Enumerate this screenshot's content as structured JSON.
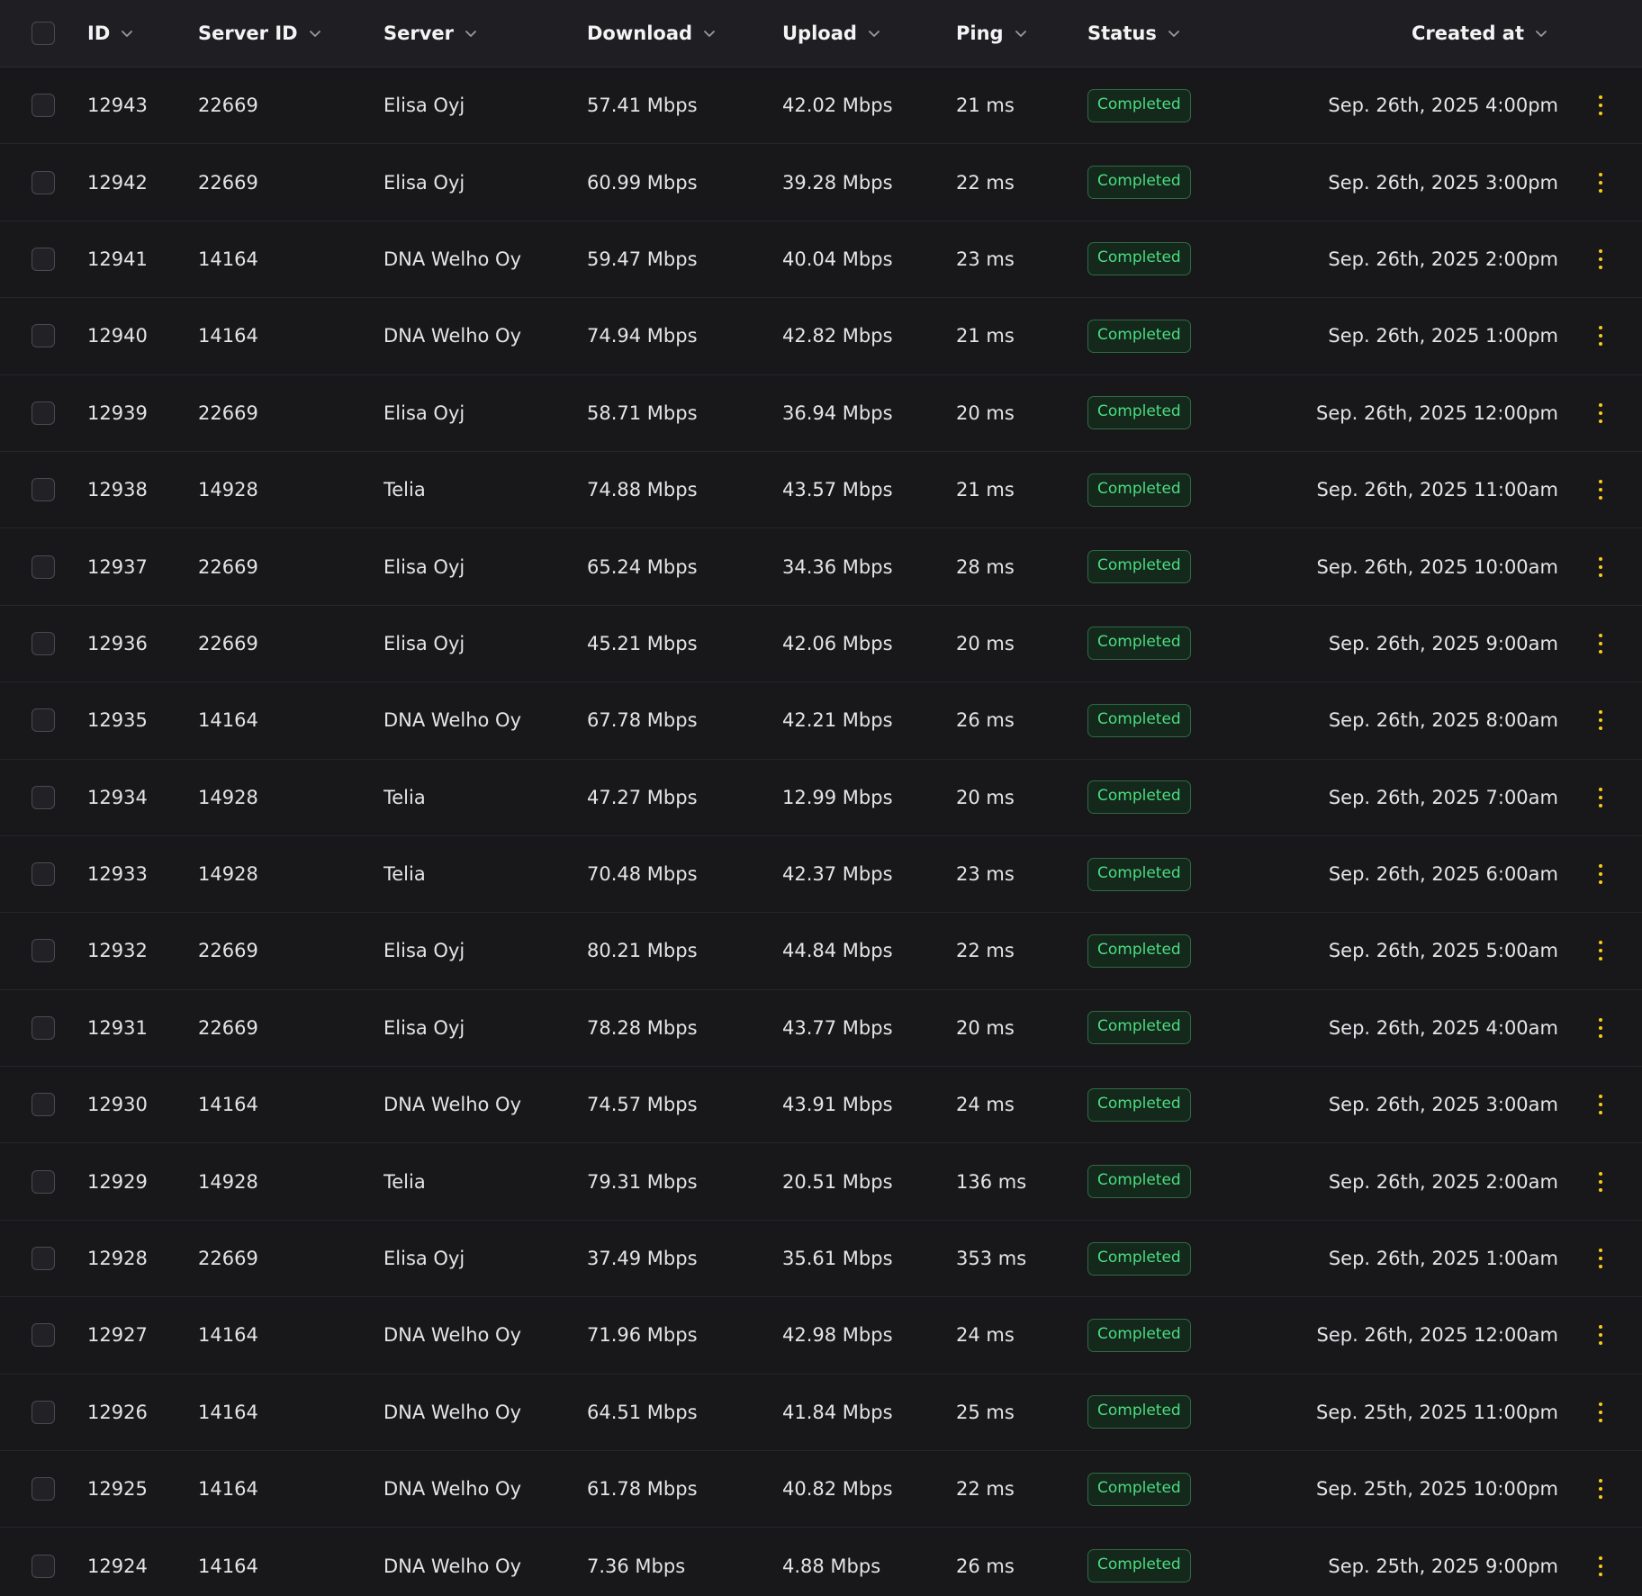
{
  "table": {
    "columns": {
      "id": "ID",
      "server_id": "Server ID",
      "server": "Server",
      "download": "Download",
      "upload": "Upload",
      "ping": "Ping",
      "status": "Status",
      "created_at": "Created at"
    },
    "rows": [
      {
        "id": "12943",
        "server_id": "22669",
        "server": "Elisa Oyj",
        "download": "57.41 Mbps",
        "upload": "42.02 Mbps",
        "ping": "21 ms",
        "status": "Completed",
        "created_at": "Sep. 26th, 2025 4:00pm"
      },
      {
        "id": "12942",
        "server_id": "22669",
        "server": "Elisa Oyj",
        "download": "60.99 Mbps",
        "upload": "39.28 Mbps",
        "ping": "22 ms",
        "status": "Completed",
        "created_at": "Sep. 26th, 2025 3:00pm"
      },
      {
        "id": "12941",
        "server_id": "14164",
        "server": "DNA Welho Oy",
        "download": "59.47 Mbps",
        "upload": "40.04 Mbps",
        "ping": "23 ms",
        "status": "Completed",
        "created_at": "Sep. 26th, 2025 2:00pm"
      },
      {
        "id": "12940",
        "server_id": "14164",
        "server": "DNA Welho Oy",
        "download": "74.94 Mbps",
        "upload": "42.82 Mbps",
        "ping": "21 ms",
        "status": "Completed",
        "created_at": "Sep. 26th, 2025 1:00pm"
      },
      {
        "id": "12939",
        "server_id": "22669",
        "server": "Elisa Oyj",
        "download": "58.71 Mbps",
        "upload": "36.94 Mbps",
        "ping": "20 ms",
        "status": "Completed",
        "created_at": "Sep. 26th, 2025 12:00pm"
      },
      {
        "id": "12938",
        "server_id": "14928",
        "server": "Telia",
        "download": "74.88 Mbps",
        "upload": "43.57 Mbps",
        "ping": "21 ms",
        "status": "Completed",
        "created_at": "Sep. 26th, 2025 11:00am"
      },
      {
        "id": "12937",
        "server_id": "22669",
        "server": "Elisa Oyj",
        "download": "65.24 Mbps",
        "upload": "34.36 Mbps",
        "ping": "28 ms",
        "status": "Completed",
        "created_at": "Sep. 26th, 2025 10:00am"
      },
      {
        "id": "12936",
        "server_id": "22669",
        "server": "Elisa Oyj",
        "download": "45.21 Mbps",
        "upload": "42.06 Mbps",
        "ping": "20 ms",
        "status": "Completed",
        "created_at": "Sep. 26th, 2025 9:00am"
      },
      {
        "id": "12935",
        "server_id": "14164",
        "server": "DNA Welho Oy",
        "download": "67.78 Mbps",
        "upload": "42.21 Mbps",
        "ping": "26 ms",
        "status": "Completed",
        "created_at": "Sep. 26th, 2025 8:00am"
      },
      {
        "id": "12934",
        "server_id": "14928",
        "server": "Telia",
        "download": "47.27 Mbps",
        "upload": "12.99 Mbps",
        "ping": "20 ms",
        "status": "Completed",
        "created_at": "Sep. 26th, 2025 7:00am"
      },
      {
        "id": "12933",
        "server_id": "14928",
        "server": "Telia",
        "download": "70.48 Mbps",
        "upload": "42.37 Mbps",
        "ping": "23 ms",
        "status": "Completed",
        "created_at": "Sep. 26th, 2025 6:00am"
      },
      {
        "id": "12932",
        "server_id": "22669",
        "server": "Elisa Oyj",
        "download": "80.21 Mbps",
        "upload": "44.84 Mbps",
        "ping": "22 ms",
        "status": "Completed",
        "created_at": "Sep. 26th, 2025 5:00am"
      },
      {
        "id": "12931",
        "server_id": "22669",
        "server": "Elisa Oyj",
        "download": "78.28 Mbps",
        "upload": "43.77 Mbps",
        "ping": "20 ms",
        "status": "Completed",
        "created_at": "Sep. 26th, 2025 4:00am"
      },
      {
        "id": "12930",
        "server_id": "14164",
        "server": "DNA Welho Oy",
        "download": "74.57 Mbps",
        "upload": "43.91 Mbps",
        "ping": "24 ms",
        "status": "Completed",
        "created_at": "Sep. 26th, 2025 3:00am"
      },
      {
        "id": "12929",
        "server_id": "14928",
        "server": "Telia",
        "download": "79.31 Mbps",
        "upload": "20.51 Mbps",
        "ping": "136 ms",
        "status": "Completed",
        "created_at": "Sep. 26th, 2025 2:00am"
      },
      {
        "id": "12928",
        "server_id": "22669",
        "server": "Elisa Oyj",
        "download": "37.49 Mbps",
        "upload": "35.61 Mbps",
        "ping": "353 ms",
        "status": "Completed",
        "created_at": "Sep. 26th, 2025 1:00am"
      },
      {
        "id": "12927",
        "server_id": "14164",
        "server": "DNA Welho Oy",
        "download": "71.96 Mbps",
        "upload": "42.98 Mbps",
        "ping": "24 ms",
        "status": "Completed",
        "created_at": "Sep. 26th, 2025 12:00am"
      },
      {
        "id": "12926",
        "server_id": "14164",
        "server": "DNA Welho Oy",
        "download": "64.51 Mbps",
        "upload": "41.84 Mbps",
        "ping": "25 ms",
        "status": "Completed",
        "created_at": "Sep. 25th, 2025 11:00pm"
      },
      {
        "id": "12925",
        "server_id": "14164",
        "server": "DNA Welho Oy",
        "download": "61.78 Mbps",
        "upload": "40.82 Mbps",
        "ping": "22 ms",
        "status": "Completed",
        "created_at": "Sep. 25th, 2025 10:00pm"
      },
      {
        "id": "12924",
        "server_id": "14164",
        "server": "DNA Welho Oy",
        "download": "7.36 Mbps",
        "upload": "4.88 Mbps",
        "ping": "26 ms",
        "status": "Completed",
        "created_at": "Sep. 25th, 2025 9:00pm"
      }
    ]
  },
  "icons": {
    "sort": "chevron-down-icon",
    "row_actions": "more-vertical-icon"
  },
  "colors": {
    "background": "#18181b",
    "header_background": "#1f1f23",
    "status_completed": "#4ade80",
    "actions_accent": "#facc15"
  }
}
